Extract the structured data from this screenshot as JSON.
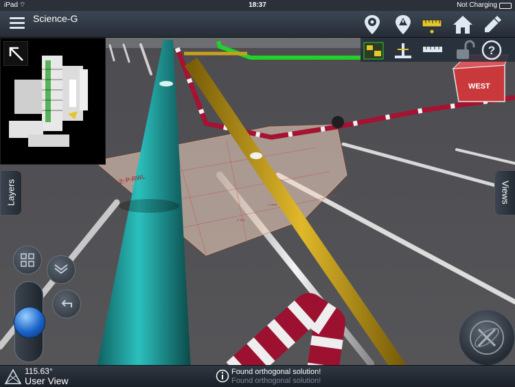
{
  "status_bar": {
    "carrier": "iPad",
    "time": "18:37",
    "battery_text": "Not Charging"
  },
  "header": {
    "title": "Science-G"
  },
  "toolbar": {
    "icons": [
      "location-pin-icon",
      "location-pin-alert-icon",
      "measure-ruler-icon",
      "home-icon",
      "pencil-icon"
    ],
    "secondary_icons": [
      "plan-view-icon",
      "elevation-icon",
      "dimension-icon",
      "unlock-icon",
      "help-icon"
    ]
  },
  "minimap": {
    "arrow_icon": "expand-arrow-icon"
  },
  "side_tabs": {
    "layers": "Layers",
    "views": "Views"
  },
  "scene": {
    "plane_label": "2: P-RWL",
    "plane_small_label_1": "1: PIPE",
    "plane_small_label_2": "2'' DIA",
    "wall_label": "WEST"
  },
  "bottom": {
    "angle": "115.63°",
    "view_name": "User View",
    "message_primary": "Found orthogonal solution!",
    "message_secondary": "Found orthogonal solution!"
  },
  "colors": {
    "accent_green": "#22d22a",
    "teal_pipe": "#1fa7a6",
    "yellow_pipe": "#c9a11a",
    "red_pipe": "#b01433"
  }
}
